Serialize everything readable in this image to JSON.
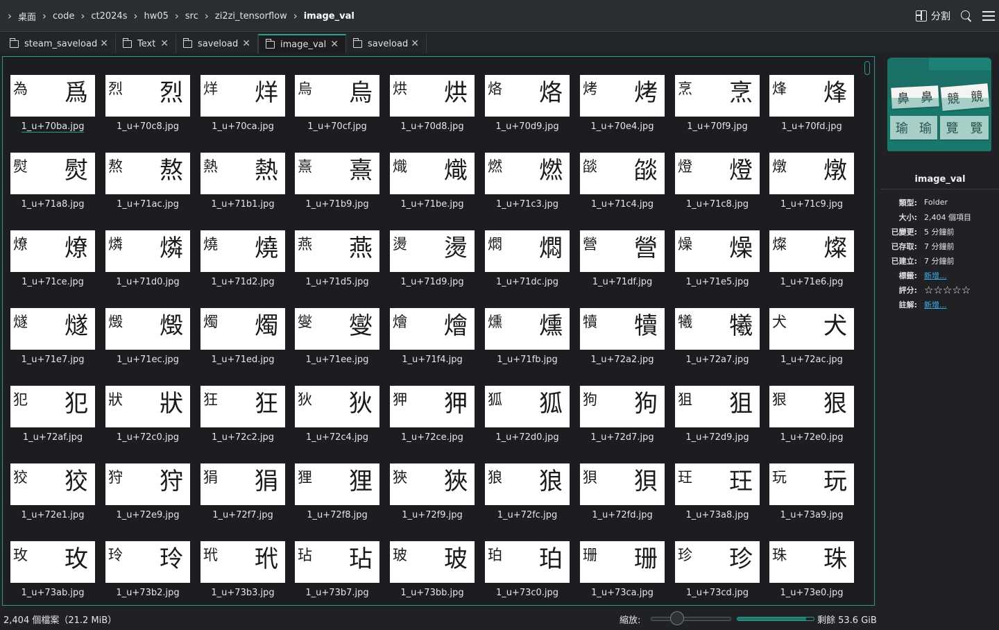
{
  "breadcrumb": [
    "桌面",
    "code",
    "ct2024s",
    "hw05",
    "src",
    "zi2zi_tensorflow",
    "image_val"
  ],
  "toolbar": {
    "split_label": "分割"
  },
  "tabs": [
    {
      "label": "steam_saveload",
      "active": false
    },
    {
      "label": "Text",
      "active": false
    },
    {
      "label": "saveload",
      "active": false
    },
    {
      "label": "image_val",
      "active": true
    },
    {
      "label": "saveload",
      "active": false
    }
  ],
  "files": [
    {
      "name": "1_u+70ba.jpg",
      "small": "為",
      "big": "爲"
    },
    {
      "name": "1_u+70c8.jpg",
      "small": "烈",
      "big": "烈"
    },
    {
      "name": "1_u+70ca.jpg",
      "small": "烊",
      "big": "烊"
    },
    {
      "name": "1_u+70cf.jpg",
      "small": "烏",
      "big": "烏"
    },
    {
      "name": "1_u+70d8.jpg",
      "small": "烘",
      "big": "烘"
    },
    {
      "name": "1_u+70d9.jpg",
      "small": "烙",
      "big": "烙"
    },
    {
      "name": "1_u+70e4.jpg",
      "small": "烤",
      "big": "烤"
    },
    {
      "name": "1_u+70f9.jpg",
      "small": "烹",
      "big": "烹"
    },
    {
      "name": "1_u+70fd.jpg",
      "small": "烽",
      "big": "烽"
    },
    {
      "name": "1_u+71a8.jpg",
      "small": "熨",
      "big": "熨"
    },
    {
      "name": "1_u+71ac.jpg",
      "small": "熬",
      "big": "熬"
    },
    {
      "name": "1_u+71b1.jpg",
      "small": "熱",
      "big": "熱"
    },
    {
      "name": "1_u+71b9.jpg",
      "small": "熹",
      "big": "熹"
    },
    {
      "name": "1_u+71be.jpg",
      "small": "熾",
      "big": "熾"
    },
    {
      "name": "1_u+71c3.jpg",
      "small": "燃",
      "big": "燃"
    },
    {
      "name": "1_u+71c4.jpg",
      "small": "燄",
      "big": "燄"
    },
    {
      "name": "1_u+71c8.jpg",
      "small": "燈",
      "big": "燈"
    },
    {
      "name": "1_u+71c9.jpg",
      "small": "燉",
      "big": "燉"
    },
    {
      "name": "1_u+71ce.jpg",
      "small": "燎",
      "big": "燎"
    },
    {
      "name": "1_u+71d0.jpg",
      "small": "燐",
      "big": "燐"
    },
    {
      "name": "1_u+71d2.jpg",
      "small": "燒",
      "big": "燒"
    },
    {
      "name": "1_u+71d5.jpg",
      "small": "燕",
      "big": "燕"
    },
    {
      "name": "1_u+71d9.jpg",
      "small": "燙",
      "big": "燙"
    },
    {
      "name": "1_u+71dc.jpg",
      "small": "燜",
      "big": "燜"
    },
    {
      "name": "1_u+71df.jpg",
      "small": "營",
      "big": "營"
    },
    {
      "name": "1_u+71e5.jpg",
      "small": "燥",
      "big": "燥"
    },
    {
      "name": "1_u+71e6.jpg",
      "small": "燦",
      "big": "燦"
    },
    {
      "name": "1_u+71e7.jpg",
      "small": "燧",
      "big": "燧"
    },
    {
      "name": "1_u+71ec.jpg",
      "small": "燬",
      "big": "燬"
    },
    {
      "name": "1_u+71ed.jpg",
      "small": "燭",
      "big": "燭"
    },
    {
      "name": "1_u+71ee.jpg",
      "small": "燮",
      "big": "燮"
    },
    {
      "name": "1_u+71f4.jpg",
      "small": "燴",
      "big": "燴"
    },
    {
      "name": "1_u+71fb.jpg",
      "small": "燻",
      "big": "燻"
    },
    {
      "name": "1_u+72a2.jpg",
      "small": "犢",
      "big": "犢"
    },
    {
      "name": "1_u+72a7.jpg",
      "small": "犧",
      "big": "犧"
    },
    {
      "name": "1_u+72ac.jpg",
      "small": "犬",
      "big": "犬"
    },
    {
      "name": "1_u+72af.jpg",
      "small": "犯",
      "big": "犯"
    },
    {
      "name": "1_u+72c0.jpg",
      "small": "狀",
      "big": "狀"
    },
    {
      "name": "1_u+72c2.jpg",
      "small": "狂",
      "big": "狂"
    },
    {
      "name": "1_u+72c4.jpg",
      "small": "狄",
      "big": "狄"
    },
    {
      "name": "1_u+72ce.jpg",
      "small": "狎",
      "big": "狎"
    },
    {
      "name": "1_u+72d0.jpg",
      "small": "狐",
      "big": "狐"
    },
    {
      "name": "1_u+72d7.jpg",
      "small": "狗",
      "big": "狗"
    },
    {
      "name": "1_u+72d9.jpg",
      "small": "狙",
      "big": "狙"
    },
    {
      "name": "1_u+72e0.jpg",
      "small": "狠",
      "big": "狠"
    },
    {
      "name": "1_u+72e1.jpg",
      "small": "狡",
      "big": "狡"
    },
    {
      "name": "1_u+72e9.jpg",
      "small": "狩",
      "big": "狩"
    },
    {
      "name": "1_u+72f7.jpg",
      "small": "狷",
      "big": "狷"
    },
    {
      "name": "1_u+72f8.jpg",
      "small": "狸",
      "big": "狸"
    },
    {
      "name": "1_u+72f9.jpg",
      "small": "狹",
      "big": "狹"
    },
    {
      "name": "1_u+72fc.jpg",
      "small": "狼",
      "big": "狼"
    },
    {
      "name": "1_u+72fd.jpg",
      "small": "狽",
      "big": "狽"
    },
    {
      "name": "1_u+73a8.jpg",
      "small": "玨",
      "big": "玨"
    },
    {
      "name": "1_u+73a9.jpg",
      "small": "玩",
      "big": "玩"
    },
    {
      "name": "1_u+73ab.jpg",
      "small": "玫",
      "big": "玫"
    },
    {
      "name": "1_u+73b2.jpg",
      "small": "玲",
      "big": "玲"
    },
    {
      "name": "1_u+73b3.jpg",
      "small": "玳",
      "big": "玳"
    },
    {
      "name": "1_u+73b7.jpg",
      "small": "玷",
      "big": "玷"
    },
    {
      "name": "1_u+73bb.jpg",
      "small": "玻",
      "big": "玻"
    },
    {
      "name": "1_u+73c0.jpg",
      "small": "珀",
      "big": "珀"
    },
    {
      "name": "1_u+73ca.jpg",
      "small": "珊",
      "big": "珊"
    },
    {
      "name": "1_u+73cd.jpg",
      "small": "珍",
      "big": "珍"
    },
    {
      "name": "1_u+73e0.jpg",
      "small": "珠",
      "big": "珠"
    }
  ],
  "panel": {
    "title": "image_val",
    "preview_chars": [
      "鼻",
      "鼻",
      "競",
      "競",
      "瑜",
      "瑜",
      "覽",
      "覽"
    ],
    "meta": [
      {
        "key": "類型:",
        "value": "Folder",
        "link": false
      },
      {
        "key": "大小:",
        "value": "2,404 個項目",
        "link": false
      },
      {
        "key": "已變更:",
        "value": "5 分鐘前",
        "link": false
      },
      {
        "key": "已存取:",
        "value": "7 分鐘前",
        "link": false
      },
      {
        "key": "已建立:",
        "value": "7 分鐘前",
        "link": false
      },
      {
        "key": "標籤:",
        "value": "新增...",
        "link": true
      },
      {
        "key": "評分:",
        "value": "☆☆☆☆☆",
        "link": false
      },
      {
        "key": "註解:",
        "value": "新增...",
        "link": true
      }
    ]
  },
  "status": {
    "count": "2,404 個檔案（21.2 MiB）",
    "zoom_label": "縮放:",
    "free_space": "剩餘 53.6 GiB",
    "used_fraction": 0.9
  },
  "colors": {
    "accent": "#2d9c8f",
    "link": "#3daee9",
    "bg": "#1b1d20"
  }
}
